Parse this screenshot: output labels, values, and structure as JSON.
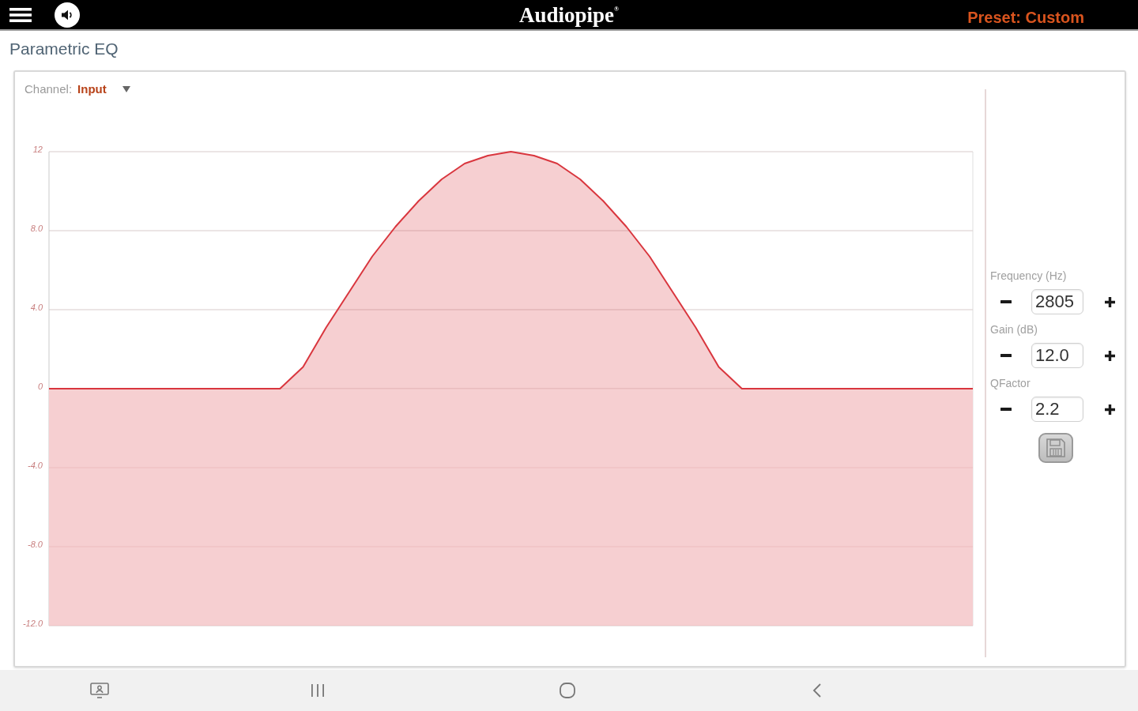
{
  "top_bar": {
    "logo": "Audiopipe$^{®}$",
    "preset": "Preset: Custom"
  },
  "page_title": "Parametric EQ",
  "eq_panel": {
    "channel_label": "Channel:",
    "channel_value": "Input",
    "chart_data": {
      "type": "area",
      "categories": [
        null,
        null,
        null,
        null,
        null,
        null,
        null,
        null,
        null,
        null,
        null,
        null,
        null,
        null,
        null,
        null,
        null,
        null,
        null,
        null,
        null,
        null,
        null,
        null,
        null,
        null,
        null,
        null,
        null,
        null,
        null,
        null,
        null,
        null,
        null,
        null,
        null,
        null,
        null,
        null,
        null
      ],
      "values": [
        0,
        0,
        0,
        0,
        0,
        0,
        0,
        0,
        0,
        0,
        0,
        1.1,
        3.1,
        4.9,
        6.7,
        8.2,
        9.5,
        10.6,
        11.4,
        11.8,
        12,
        11.8,
        11.4,
        10.6,
        9.5,
        8.2,
        6.7,
        4.9,
        3.1,
        1.1,
        0,
        0,
        0,
        0,
        0,
        0,
        0,
        0,
        0,
        0,
        0
      ],
      "color": "#d9363e",
      "ylim": [
        -12,
        12
      ],
      "yticks": [
        {
          "value": 12,
          "label": "12"
        },
        {
          "value": 8,
          "label": "8.0"
        },
        {
          "value": 4,
          "label": "4.0"
        },
        {
          "value": 0,
          "label": "0"
        },
        {
          "value": -4,
          "label": "-4.0"
        },
        {
          "value": -8,
          "label": "-8.0"
        },
        {
          "value": -12,
          "label": "-12.0"
        }
      ],
      "bands": [
        {
          "axis": "y",
          "from": -12,
          "to": 0,
          "color": "#f6cfd1"
        }
      ],
      "grid": true
    },
    "controls": [
      {
        "label": "Frequency (Hz)",
        "value": "2805"
      },
      {
        "label": "Gain (dB)",
        "value": "12.0"
      },
      {
        "label": "QFactor",
        "value": "2.2"
      }
    ]
  }
}
